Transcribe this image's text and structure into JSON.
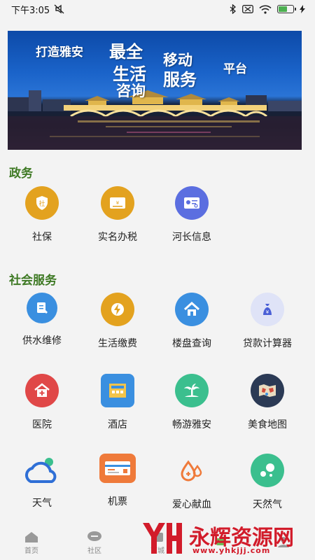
{
  "status_bar": {
    "time": "下午3:05",
    "icons": [
      "mute-icon",
      "bluetooth-icon",
      "sim-icon",
      "wifi-icon",
      "battery-icon",
      "charging-icon"
    ],
    "battery_level": 0.6
  },
  "banner": {
    "line1": "打造雅安",
    "line2": "最全",
    "line3": "移动",
    "line4": "生活",
    "line5": "服务",
    "line6": "咨询",
    "line7": "平台"
  },
  "sections": {
    "government": {
      "title": "政务",
      "items": [
        {
          "label": "社保",
          "icon": "shield-badge-icon",
          "color": "#e3a21f"
        },
        {
          "label": "实名办税",
          "icon": "tax-card-icon",
          "color": "#e3a21f"
        },
        {
          "label": "河长信息",
          "icon": "id-card-icon",
          "color": "#5b6ee0"
        }
      ]
    },
    "social": {
      "title": "社会服务",
      "items": [
        {
          "label": "供水维修",
          "icon": "water-repair-icon",
          "color": "#3a8fe0"
        },
        {
          "label": "生活缴费",
          "icon": "lightning-icon",
          "color": "#e3a21f"
        },
        {
          "label": "楼盘查询",
          "icon": "house-icon",
          "color": "#3a8fe0"
        },
        {
          "label": "贷款计算器",
          "icon": "money-bag-icon",
          "color": "#dfe3f7"
        },
        {
          "label": "医院",
          "icon": "hospital-icon",
          "color": "#e04848"
        },
        {
          "label": "酒店",
          "icon": "hotel-icon",
          "color": "#3a8fe0"
        },
        {
          "label": "畅游雅安",
          "icon": "palm-tree-icon",
          "color": "#3bbf8e"
        },
        {
          "label": "美食地图",
          "icon": "map-icon",
          "color": "#2b3a55"
        },
        {
          "label": "天气",
          "icon": "weather-cloud-icon",
          "color": "#3a8fe0"
        },
        {
          "label": "机票",
          "icon": "ticket-icon",
          "color": "#ef7a3a"
        },
        {
          "label": "爱心献血",
          "icon": "blood-drop-icon",
          "color": "#ef7a3a"
        },
        {
          "label": "天然气",
          "icon": "gas-bubbles-icon",
          "color": "#3bbf8e"
        }
      ]
    }
  },
  "bottom_nav": {
    "items": [
      {
        "label": "首页",
        "icon": "home-icon"
      },
      {
        "label": "社区",
        "icon": "chat-icon"
      },
      {
        "label": "商城",
        "icon": "shop-icon"
      },
      {
        "label": "",
        "icon": "cart-icon"
      },
      {
        "label": "",
        "icon": "profile-icon"
      }
    ]
  },
  "watermark": {
    "brand": "永辉资源网",
    "url": "www.yhkjjj.com",
    "logo_letters": "YH"
  }
}
